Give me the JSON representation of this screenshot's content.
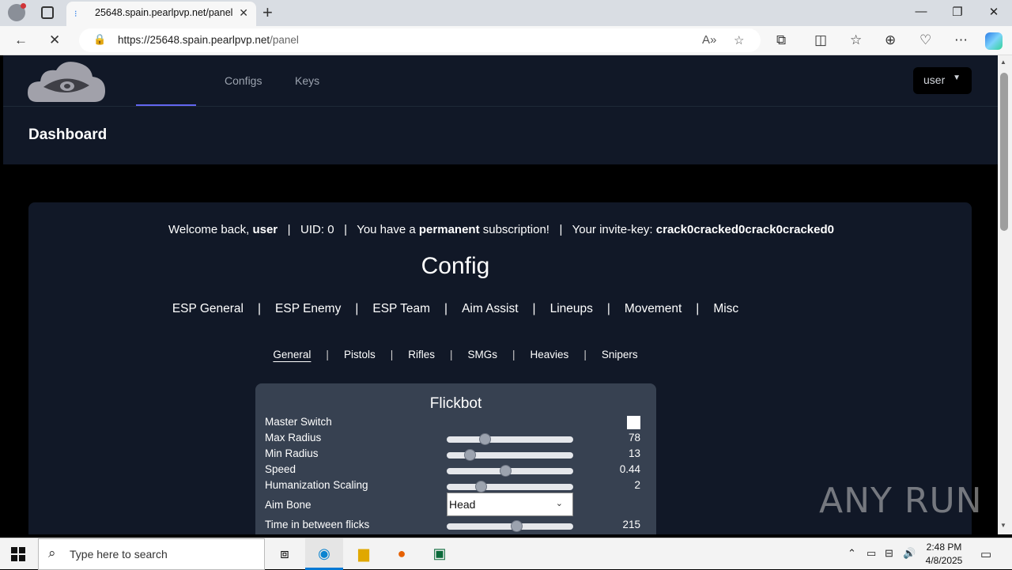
{
  "browser": {
    "tab_title": "25648.spain.pearlpvp.net/panel",
    "url_host": "https://25648.spain.pearlpvp.net",
    "url_path": "/panel"
  },
  "site": {
    "nav": [
      "Configs",
      "Keys"
    ],
    "user_menu": "user",
    "dashboard_title": "Dashboard"
  },
  "welcome": {
    "prefix": "Welcome back, ",
    "username": "user",
    "uid": "UID: 0",
    "sub_prefix": "You have a ",
    "sub_type": "permanent",
    "sub_suffix": " subscription!",
    "invite_prefix": "Your invite-key: ",
    "invite_key": "crack0cracked0crack0cracked0"
  },
  "config": {
    "title": "Config",
    "categories": [
      "ESP General",
      "ESP Enemy",
      "ESP Team",
      "Aim Assist",
      "Lineups",
      "Movement",
      "Misc"
    ],
    "weapon_tabs": [
      "General",
      "Pistols",
      "Rifles",
      "SMGs",
      "Heavies",
      "Snipers"
    ],
    "active_weapon_tab": "General"
  },
  "flickbot": {
    "title": "Flickbot",
    "master_switch_label": "Master Switch",
    "max_radius": {
      "label": "Max Radius",
      "value": "78",
      "fraction": 0.3
    },
    "min_radius": {
      "label": "Min Radius",
      "value": "13",
      "fraction": 0.18
    },
    "speed": {
      "label": "Speed",
      "value": "0.44",
      "fraction": 0.46
    },
    "humanization": {
      "label": "Humanization Scaling",
      "value": "2",
      "fraction": 0.27
    },
    "aim_bone": {
      "label": "Aim Bone",
      "value": "Head"
    },
    "flick_delay": {
      "label": "Time in between flicks",
      "value": "215",
      "fraction": 0.55
    }
  },
  "watermark": "ANY RUN",
  "taskbar": {
    "search_placeholder": "Type here to search",
    "time": "2:48 PM",
    "date": "4/8/2025"
  }
}
